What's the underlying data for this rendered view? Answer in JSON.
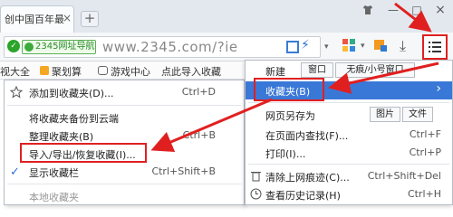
{
  "tab": {
    "title": "创中国百年最",
    "close": "×"
  },
  "newtab": "+",
  "window": {
    "shirt": "👕",
    "minimize": "—",
    "maximize": "□",
    "close": "×"
  },
  "address": {
    "secure_glyph": "✓",
    "nav_badge": "2345网址导航",
    "url": "www.2345.com/?ie",
    "dropdown": "▾",
    "download": "⤓"
  },
  "bookmarks": {
    "items": [
      "视大全",
      "聚划算",
      "游戏中心",
      "点此导入收藏"
    ]
  },
  "favorites_menu": {
    "items": [
      {
        "label": "添加到收藏夹(D)...",
        "shortcut": "Ctrl+D"
      },
      {
        "label": "将收藏夹备份到云端",
        "shortcut": ""
      },
      {
        "label": "整理收藏夹(B)",
        "shortcut": "Ctrl+B"
      },
      {
        "label": "导入/导出/恢复收藏(I)...",
        "shortcut": ""
      },
      {
        "label": "显示收藏栏",
        "shortcut": "Ctrl+Shift+B",
        "checked": "✓"
      },
      {
        "label": "本地收藏夹",
        "shortcut": ""
      }
    ]
  },
  "main_menu": {
    "new_label": "新建",
    "new_window": "窗口",
    "new_incognito": "无痕/小号窗口",
    "favorites": "收藏夹(B)",
    "favorites_arrow": "›",
    "save_as": "网页另存为",
    "save_image": "图片",
    "save_file": "文件",
    "find": "在页面内查找(F)...",
    "find_shortcut": "Ctrl+F",
    "print": "打印(I)...",
    "print_shortcut": "Ctrl+P",
    "clear": "清除上网痕迹(C)...",
    "clear_shortcut": "Ctrl+Shift+Del",
    "history": "查看历史记录(H)",
    "history_shortcut": "Ctrl+H"
  },
  "colors": {
    "highlight": "#3a78d8",
    "annotation": "#e02020",
    "accent_green": "#2aa52a"
  }
}
